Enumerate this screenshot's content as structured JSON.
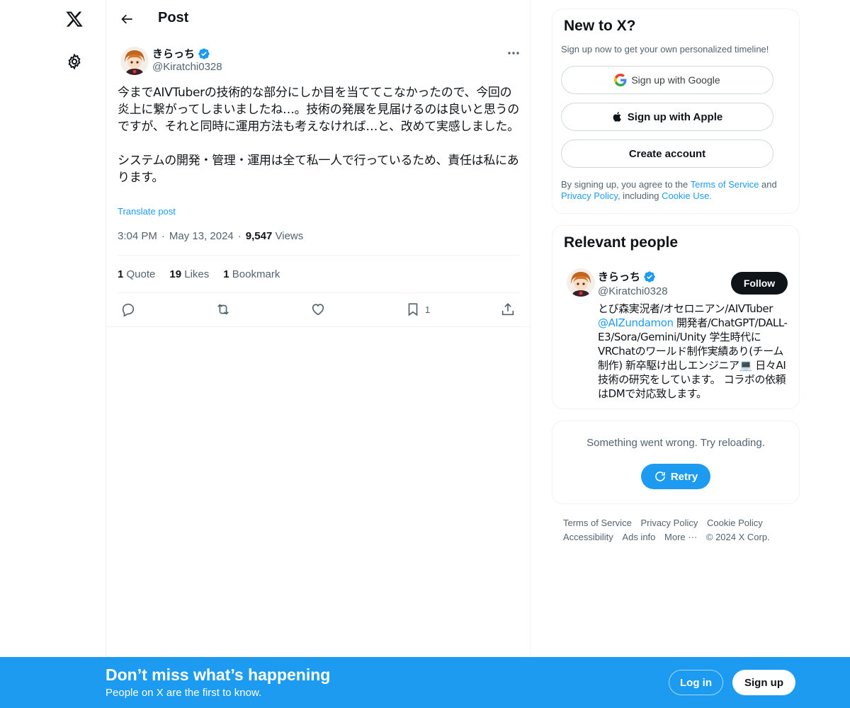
{
  "header": {
    "title": "Post"
  },
  "post": {
    "author_name": "きらっち",
    "author_handle": "@Kiratchi0328",
    "text": "今までAIVTuberの技術的な部分にしか目を当ててこなかったので、今回の炎上に繋がってしまいましたね…。技術の発展を見届けるのは良いと思うのですが、それと同時に運用方法も考えなければ…と、改めて実感しました。\n\nシステムの開発・管理・運用は全て私一人で行っているため、責任は私にあります。",
    "translate_label": "Translate post",
    "time": "3:04 PM",
    "date": "May 13, 2024",
    "views_count": "9,547",
    "views_label": "Views",
    "separator": "·",
    "stats": {
      "quotes_count": "1",
      "quotes_label": "Quote",
      "likes_count": "19",
      "likes_label": "Likes",
      "bookmarks_count": "1",
      "bookmarks_label": "Bookmark"
    },
    "actions": {
      "bookmark_count": "1"
    }
  },
  "signup_card": {
    "title": "New to X?",
    "subtitle": "Sign up now to get your own personalized timeline!",
    "google_label": "Sign up with Google",
    "apple_label": "Sign up with Apple",
    "create_label": "Create account",
    "legal_prefix": "By signing up, you agree to the ",
    "terms_link": "Terms of Service",
    "legal_and": " and ",
    "privacy_link": "Privacy Policy",
    "legal_including": ", including ",
    "cookie_link": "Cookie Use."
  },
  "relevant_people": {
    "title": "Relevant people",
    "name": "きらっち",
    "handle": "@Kiratchi0328",
    "follow_label": "Follow",
    "bio_part1": "とび森実況者/オセロニアン/AIVTuber ",
    "bio_mention": "@AIZundamon",
    "bio_part2": " 開発者/ChatGPT/DALL-E3/Sora/Gemini/Unity 学生時代にVRChatのワールド制作実績あり(チーム制作) 新卒駆け出しエンジニア💻 日々AI技術の研究をしています。 コラボの依頼はDMで対応致します。"
  },
  "error_card": {
    "message": "Something went wrong. Try reloading.",
    "retry_label": "Retry"
  },
  "footer": {
    "links": [
      "Terms of Service",
      "Privacy Policy",
      "Cookie Policy",
      "Accessibility",
      "Ads info",
      "More ···",
      "© 2024 X Corp."
    ]
  },
  "bottom_bar": {
    "title": "Don’t miss what’s happening",
    "subtitle": "People on X are the first to know.",
    "login_label": "Log in",
    "signup_label": "Sign up"
  },
  "colors": {
    "accent": "#1d9bf0",
    "text": "#0f1419",
    "muted": "#536471",
    "border": "#eff3f4"
  },
  "icons": [
    "x-logo-icon",
    "gear-icon",
    "back-arrow-icon",
    "verified-icon",
    "more-icon",
    "reply-icon",
    "repost-icon",
    "like-icon",
    "bookmark-icon",
    "share-icon",
    "google-icon",
    "apple-icon",
    "retry-icon"
  ]
}
